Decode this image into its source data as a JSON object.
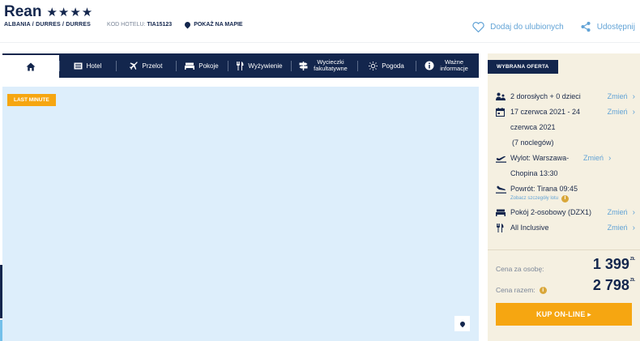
{
  "hotel": {
    "name": "Rean",
    "stars": "★★★★",
    "location": "ALBANIA / DURRES / DURRES",
    "code_label": "KOD HOTELU:",
    "code_value": "TIA15123",
    "map_label": "POKAŻ NA MAPIE"
  },
  "actions": {
    "favorite": "Dodaj do ulubionych",
    "share": "Udostępnij"
  },
  "tabs": [
    {
      "label": "",
      "icon": "home-icon"
    },
    {
      "label": "Hotel",
      "icon": "hotel-icon"
    },
    {
      "label": "Przelot",
      "icon": "plane-icon"
    },
    {
      "label": "Pokoje",
      "icon": "bed-icon"
    },
    {
      "label": "Wyżywienie",
      "icon": "fork-knife-icon"
    },
    {
      "label": "Wycieczki fakultatywne",
      "icon": "signpost-icon"
    },
    {
      "label": "Pogoda",
      "icon": "sun-icon"
    },
    {
      "label": "Ważne informacje",
      "icon": "info-icon"
    }
  ],
  "gallery": {
    "badge": "LAST MINUTE"
  },
  "offer": {
    "title": "WYBRANA OFERTA",
    "change_label": "Zmień",
    "guests": "2 dorosłych + 0 dzieci",
    "dates": "17 czerwca 2021 - 24 czerwca 2021",
    "nights": "(7 noclegów)",
    "departure": "Wylot: Warszawa-Chopina 13:30",
    "return": "Powrót: Tirana 09:45",
    "flight_details": "Zobacz szczegóły lotu",
    "room": "Pokój 2-osobowy (DZX1)",
    "board": "All Inclusive",
    "price_per_person_label": "Cena za osobę:",
    "price_per_person": "1 399",
    "price_total_label": "Cena razem:",
    "price_total": "2 798",
    "currency": "ZŁ",
    "buy_label": "KUP ON-LINE ▸"
  },
  "colors": {
    "navy": "#13264d",
    "accent_blue": "#62a3d6",
    "orange": "#f6a611",
    "panel_bg": "#f5f0e1",
    "image_bg": "#ddeefb"
  }
}
